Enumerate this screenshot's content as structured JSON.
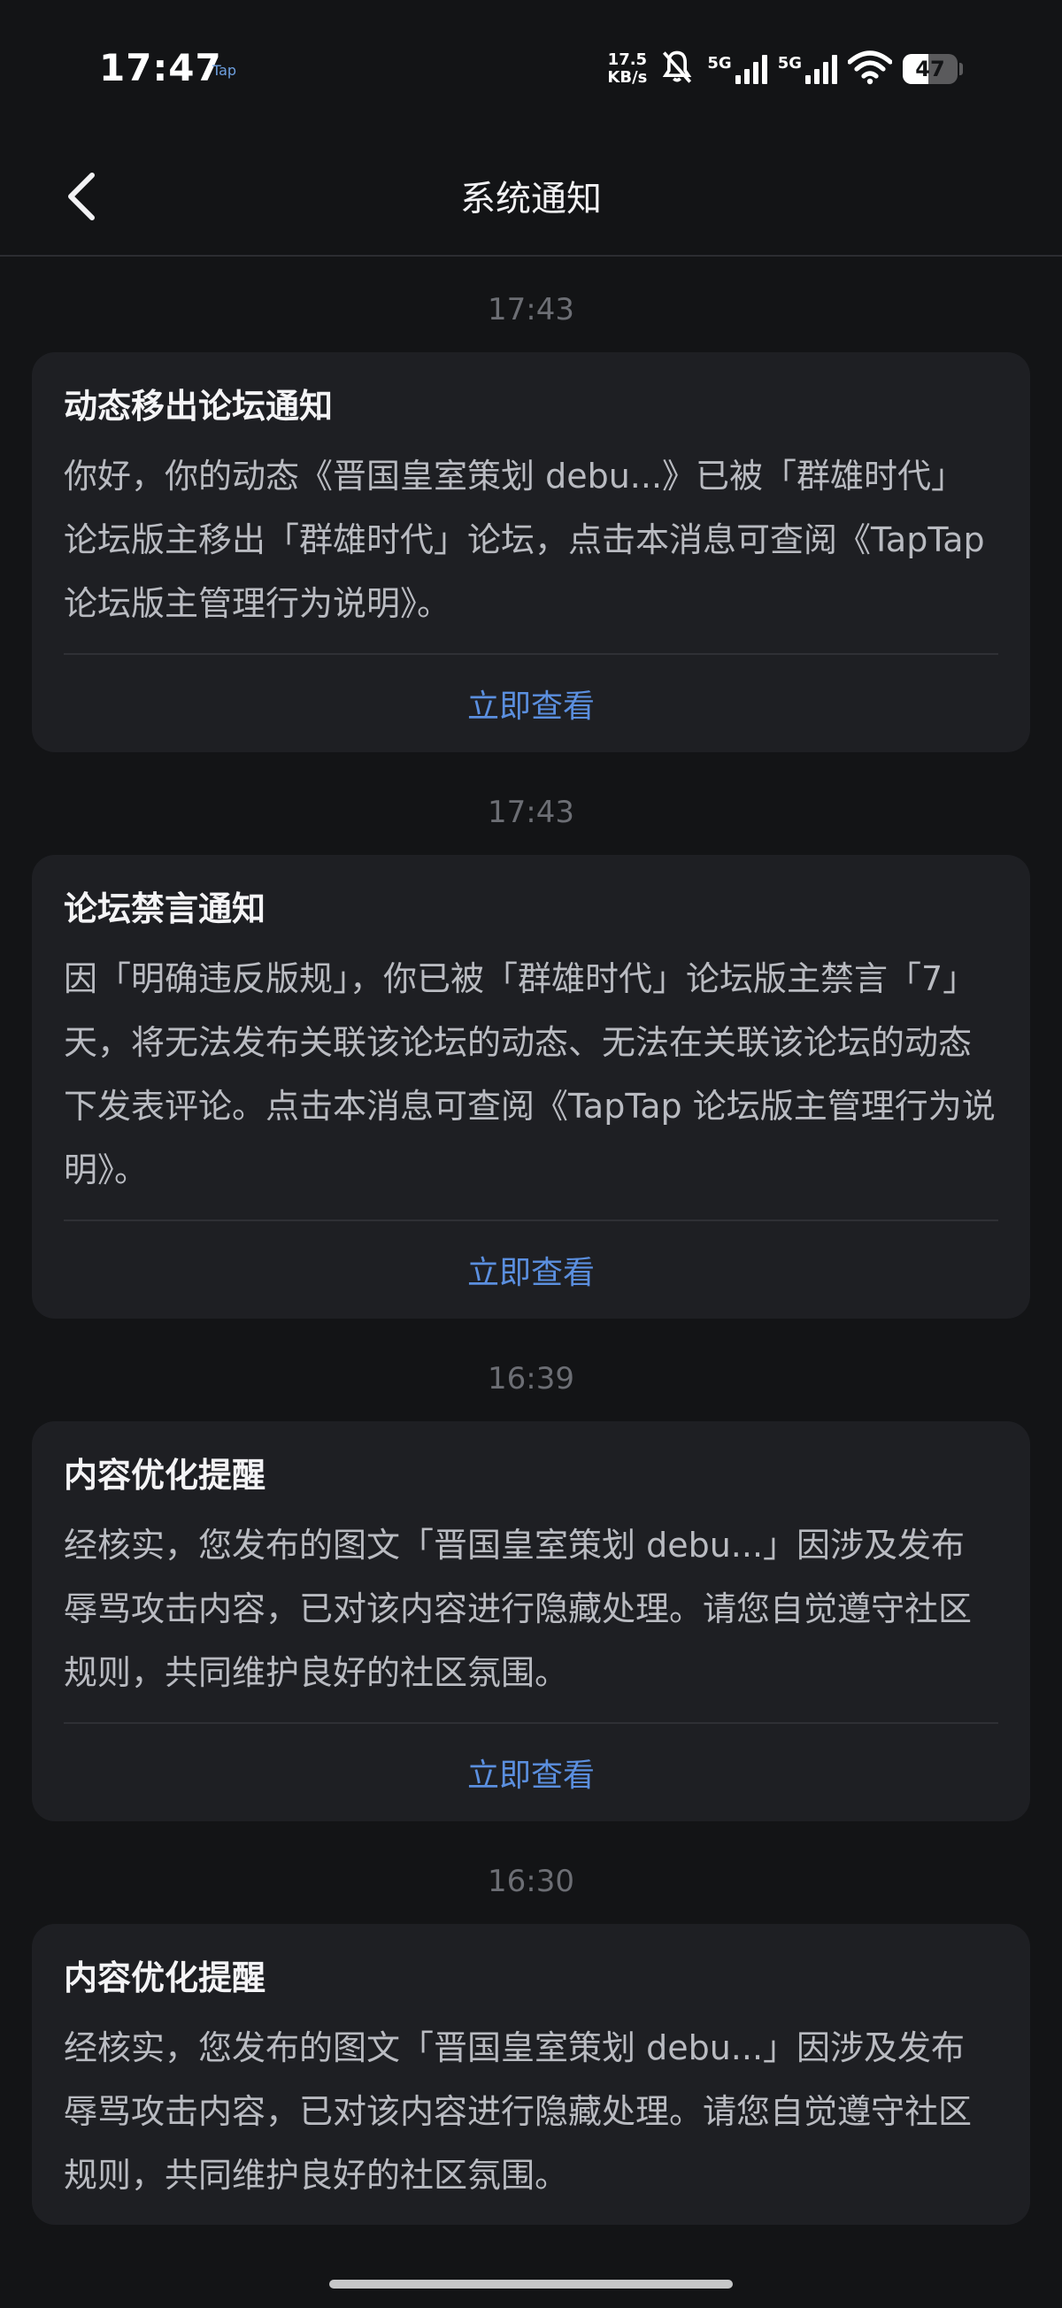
{
  "status_bar": {
    "time": "17:47",
    "app_label": "Tap",
    "net_speed_value": "17.5",
    "net_speed_unit": "KB/s",
    "network_1": "5G",
    "network_2": "5G",
    "battery_level": "47"
  },
  "header": {
    "title": "系统通知"
  },
  "notifications": [
    {
      "time": "17:43",
      "title": "动态移出论坛通知",
      "body": "你好，你的动态《晋国皇室策划 debu...》已被「群雄时代」论坛版主移出「群雄时代」论坛，点击本消息可查阅《TapTap论坛版主管理行为说明》。",
      "action": "立即查看"
    },
    {
      "time": "17:43",
      "title": "论坛禁言通知",
      "body": "因「明确违反版规」，你已被「群雄时代」论坛版主禁言「7」天，将无法发布关联该论坛的动态、无法在关联该论坛的动态下发表评论。点击本消息可查阅《TapTap 论坛版主管理行为说明》。",
      "action": "立即查看"
    },
    {
      "time": "16:39",
      "title": "内容优化提醒",
      "body": "经核实，您发布的图文「晋国皇室策划 debu...」因涉及发布辱骂攻击内容，已对该内容进行隐藏处理。请您自觉遵守社区规则，共同维护良好的社区氛围。",
      "action": "立即查看"
    },
    {
      "time": "16:30",
      "title": "内容优化提醒",
      "body": "经核实，您发布的图文「晋国皇室策划 debu...」因涉及发布辱骂攻击内容，已对该内容进行隐藏处理。请您自觉遵守社区规则，共同维护良好的社区氛围。",
      "action": ""
    }
  ],
  "colors": {
    "background": "#131416",
    "card": "#1e1f23",
    "accent": "#5b8fdf"
  }
}
